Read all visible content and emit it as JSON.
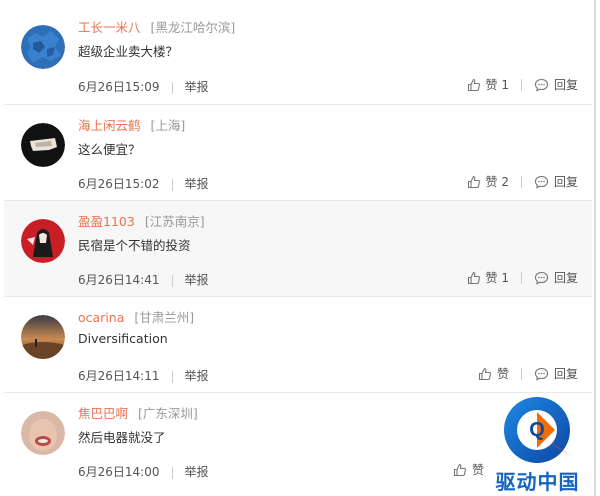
{
  "comments": [
    {
      "username": "工长一米八",
      "location": "[黑龙江哈尔滨]",
      "text": "超级企业卖大楼？",
      "time": "6月26日15:09",
      "report": "举报",
      "like": "赞 1",
      "reply": "回复"
    },
    {
      "username": "海上闲云鹤",
      "location": "[上海]",
      "text": "这么便宜？",
      "time": "6月26日15:02",
      "report": "举报",
      "like": "赞 2",
      "reply": "回复"
    },
    {
      "username": "盈盈1103",
      "location": "[江苏南京]",
      "text": "民宿是个不错的投资",
      "time": "6月26日14:41",
      "report": "举报",
      "like": "赞 1",
      "reply": "回复"
    },
    {
      "username": "ocarina",
      "location": "[甘肃兰州]",
      "text": "Diversification",
      "time": "6月26日14:11",
      "report": "举报",
      "like": "赞",
      "reply": "回复"
    },
    {
      "username": "焦巴巴啊",
      "location": "[广东深圳]",
      "text": "然后电器就没了",
      "time": "6月26日14:00",
      "report": "举报",
      "like": "赞",
      "reply": "回复"
    }
  ],
  "watermark": {
    "text": "驱动中国",
    "letter": "Q"
  },
  "colors": {
    "username": "#eb7350",
    "location": "#999999",
    "highlight_row": "#f7f7f7"
  }
}
